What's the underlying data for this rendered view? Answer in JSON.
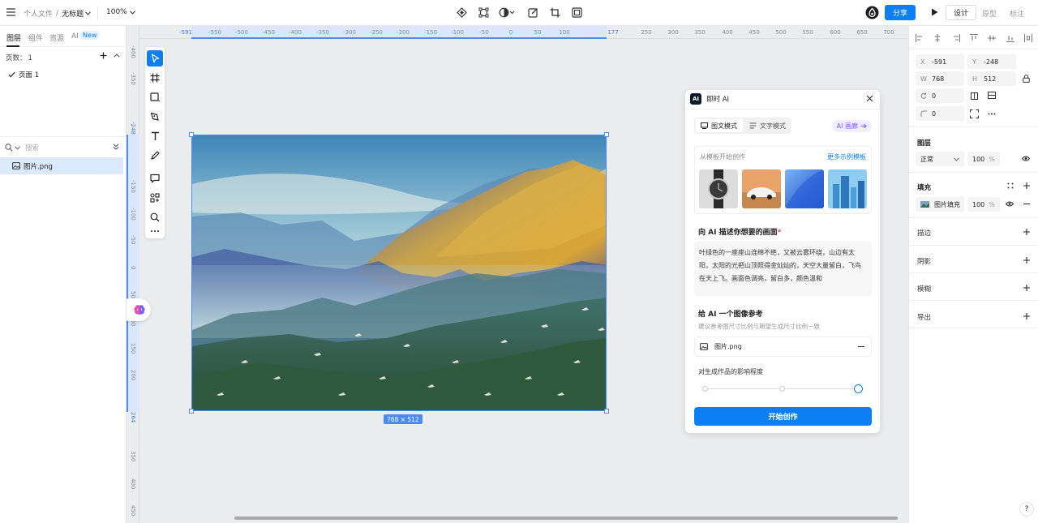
{
  "topbar": {
    "breadcrumb_parent": "个人文件",
    "breadcrumb_sep": "/",
    "doc_title": "无标题",
    "zoom": "100%",
    "share_label": "分享",
    "mode_tabs": [
      "设计",
      "原型",
      "标注"
    ]
  },
  "left_panel": {
    "tabs": [
      "图层",
      "组件",
      "资源",
      "AI"
    ],
    "new_badge": "New",
    "pages_label": "页数：",
    "pages_count": "1",
    "page_item": "页面 1",
    "search_placeholder": "搜索",
    "layer_item": "图片.png"
  },
  "rulers": {
    "top": [
      "-591",
      "-550",
      "-500",
      "-450",
      "-400",
      "-350",
      "-300",
      "-250",
      "-200",
      "-150",
      "-100",
      "-50",
      "0",
      "50",
      "100",
      "177",
      "250",
      "300",
      "350",
      "400",
      "450",
      "500",
      "550",
      "600",
      "650",
      "700"
    ],
    "left": [
      "-400",
      "-350",
      "-248",
      "-150",
      "-100",
      "-50",
      "0",
      "50",
      "100",
      "150",
      "200",
      "264",
      "350",
      "400",
      "450"
    ]
  },
  "canvas": {
    "size_label": "768 × 512"
  },
  "ai_panel": {
    "title": "即时 AI",
    "logo_text": "AI",
    "mode_image_text": "图文模式",
    "mode_text": "文字模式",
    "gallery_label": "AI 画廊",
    "templates_label": "从模板开始创作",
    "more_templates": "更多示例模板",
    "describe_title": "向 AI 描述你想要的画面",
    "required_mark": "*",
    "prompt": "叶绿色的一座座山连绵不绝，又被云雾环绕，山边有太阳，太阳的光把山顶照得金灿灿的，天空大量留白，飞鸟在天上飞。画面色调亮，留白多，颜色温和",
    "ref_title": "给 AI 一个图像参考",
    "ref_hint": "建议参考图尺寸比例与期望生成尺寸比例一致",
    "ref_file": "图片.png",
    "influence_label": "对生成作品的影响程度",
    "influence_level": 1.0,
    "start_button": "开始创作"
  },
  "right_panel": {
    "x_key": "X",
    "x_val": "-591",
    "y_key": "Y",
    "y_val": "-248",
    "w_key": "W",
    "w_val": "768",
    "h_key": "H",
    "h_val": "512",
    "rotation": "0",
    "radius": "0",
    "layer_title": "图层",
    "blend_mode": "正常",
    "opacity": "100",
    "percent": "%",
    "fill_title": "填充",
    "fill_type": "图片填充",
    "fill_opacity": "100",
    "stroke_title": "描边",
    "shadow_title": "阴影",
    "blur_title": "模糊",
    "export_title": "导出"
  },
  "help": "?",
  "colors": {
    "accent": "#0d7ff2",
    "selection": "#4a8cf7",
    "ai_purple": "#7b5cf5"
  }
}
